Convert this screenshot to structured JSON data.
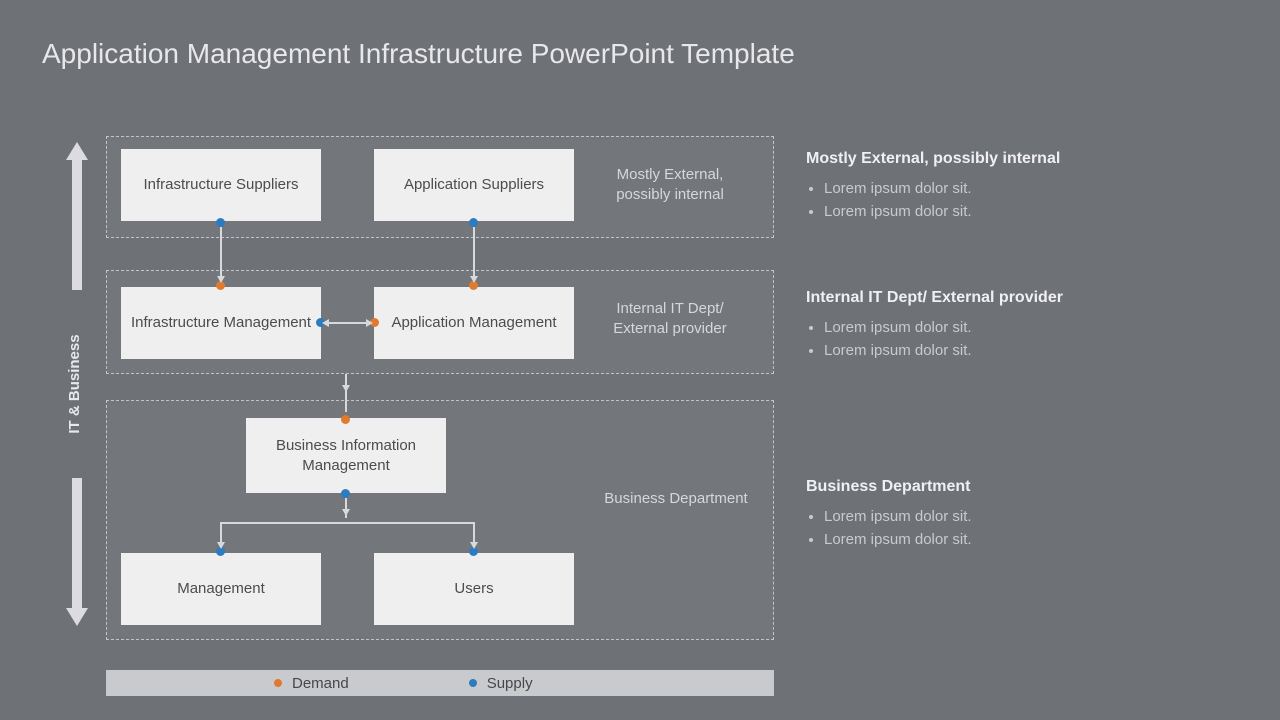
{
  "title": "Application Management Infrastructure PowerPoint Template",
  "axis_label": "IT & Business",
  "rows": {
    "r1": {
      "label": "Mostly External, possibly internal"
    },
    "r2": {
      "label": "Internal IT Dept/ External provider"
    },
    "r3": {
      "label": "Business Department"
    }
  },
  "boxes": {
    "infra_sup": "Infrastructure Suppliers",
    "app_sup": "Application Suppliers",
    "infra_mgmt": "Infrastructure Management",
    "app_mgmt": "Application Management",
    "bim": "Business Information Management",
    "mgmt": "Management",
    "users": "Users"
  },
  "legend": {
    "demand": "Demand",
    "supply": "Supply"
  },
  "desc": {
    "d1": {
      "heading": "Mostly External, possibly internal",
      "b1": "Lorem ipsum dolor sit.",
      "b2": "Lorem ipsum dolor sit."
    },
    "d2": {
      "heading": "Internal IT Dept/ External provider",
      "b1": "Lorem ipsum dolor sit.",
      "b2": "Lorem ipsum dolor sit."
    },
    "d3": {
      "heading": "Business Department",
      "b1": "Lorem ipsum dolor sit.",
      "b2": "Lorem ipsum dolor sit."
    }
  },
  "colors": {
    "demand": "#e07a2e",
    "supply": "#2d7cc1"
  }
}
